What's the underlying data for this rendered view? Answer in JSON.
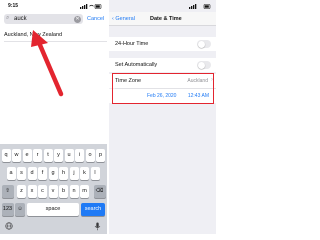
{
  "left": {
    "status_time": "9:15",
    "search": {
      "query": "auck",
      "cancel_label": "Cancel"
    },
    "result": "Auckland, New Zealand",
    "keyboard": {
      "row1": [
        "q",
        "w",
        "e",
        "r",
        "t",
        "y",
        "u",
        "i",
        "o",
        "p"
      ],
      "row2": [
        "a",
        "s",
        "d",
        "f",
        "g",
        "h",
        "j",
        "k",
        "l"
      ],
      "row3": [
        "z",
        "x",
        "c",
        "v",
        "b",
        "n",
        "m"
      ],
      "num_label": "123",
      "space_label": "space",
      "search_label": "search"
    }
  },
  "right": {
    "back_label": "General",
    "title": "Date & Time",
    "hour24_label": "24-Hour Time",
    "set_auto_label": "Set Automatically",
    "timezone_label": "Time Zone",
    "timezone_value": "Auckland",
    "date_value": "Feb 26, 2020",
    "time_value": "12:43 AM"
  },
  "colors": {
    "accent": "#1f7af5",
    "highlight": "#e3252f"
  },
  "icons": {
    "search": "magnifier-icon",
    "clear": "clear-icon",
    "shift": "shift-icon",
    "backspace": "backspace-icon",
    "emoji": "emoji-icon",
    "mic": "mic-icon",
    "arrow": "red-arrow-icon"
  }
}
